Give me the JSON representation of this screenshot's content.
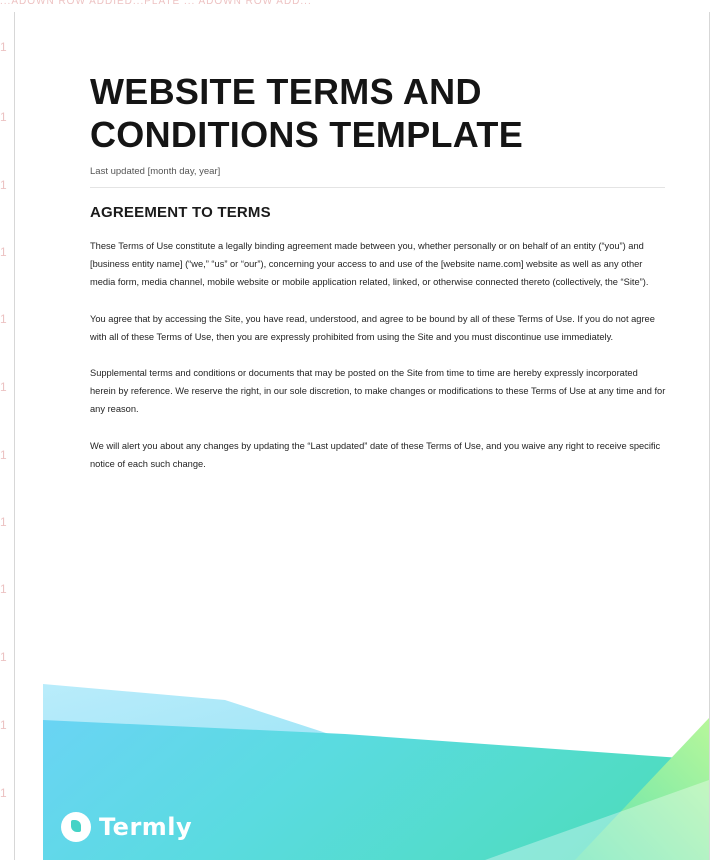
{
  "watermark": {
    "top_text": "...ADOWN ROW ADDIED...PLATE ... ADOWN ROW ADD..."
  },
  "document": {
    "title_line1": "WEBSITE TERMS AND",
    "title_line2": "CONDITIONS TEMPLATE",
    "last_updated": "Last updated [month day, year]",
    "section_heading": "AGREEMENT TO TERMS",
    "paragraphs": [
      "These Terms of Use constitute a legally binding agreement made between you, whether personally or on behalf of an entity (“you”) and [business entity name] (“we,” “us” or “our”), concerning your access to and use of the [website name.com] website as well as any other media form, media channel, mobile website or mobile application related, linked, or otherwise connected thereto (collectively, the “Site”).",
      "You agree that by accessing the Site, you have read, understood, and agree to be bound by all of these Terms of Use. If you do not agree with all of these Terms of Use, then you are expressly prohibited from using the Site and you must discontinue use immediately.",
      "Supplemental terms and conditions or documents that may be posted on the Site from time to time are hereby expressly incorporated herein by reference. We reserve the right, in our sole discretion, to make changes or modifications to these Terms of Use at any time and for any reason.",
      "We will alert you about any changes by updating the “Last updated” date of these Terms of Use, and you waive any right to receive specific notice of each such change."
    ]
  },
  "brand": {
    "name": "Termly",
    "icon": "termly-logo-icon"
  },
  "colors": {
    "gradient_cyan": "#5fd6f2",
    "gradient_teal": "#4fd9c3",
    "gradient_green": "#8ef08a",
    "title_text": "#151515",
    "body_text": "#242424",
    "watermark_red": "#e4a9a9"
  }
}
